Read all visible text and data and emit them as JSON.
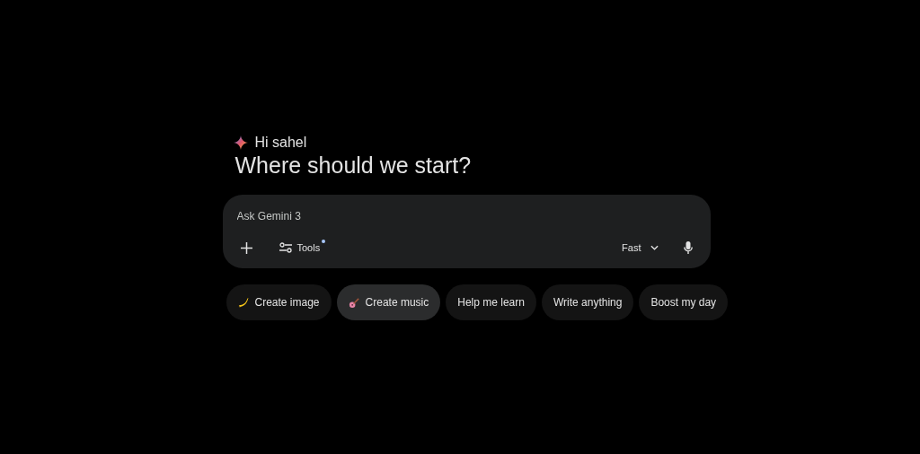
{
  "greeting": "Hi sahel",
  "heading": "Where should we start?",
  "prompt": {
    "placeholder": "Ask Gemini 3"
  },
  "tools": {
    "label": "Tools",
    "dot": true
  },
  "mode": {
    "label": "Fast"
  },
  "chips": [
    {
      "label": "Create image",
      "selected": false
    },
    {
      "label": "Create music",
      "selected": true
    },
    {
      "label": "Help me learn",
      "selected": false
    },
    {
      "label": "Write anything",
      "selected": false
    },
    {
      "label": "Boost my day",
      "selected": false
    }
  ]
}
